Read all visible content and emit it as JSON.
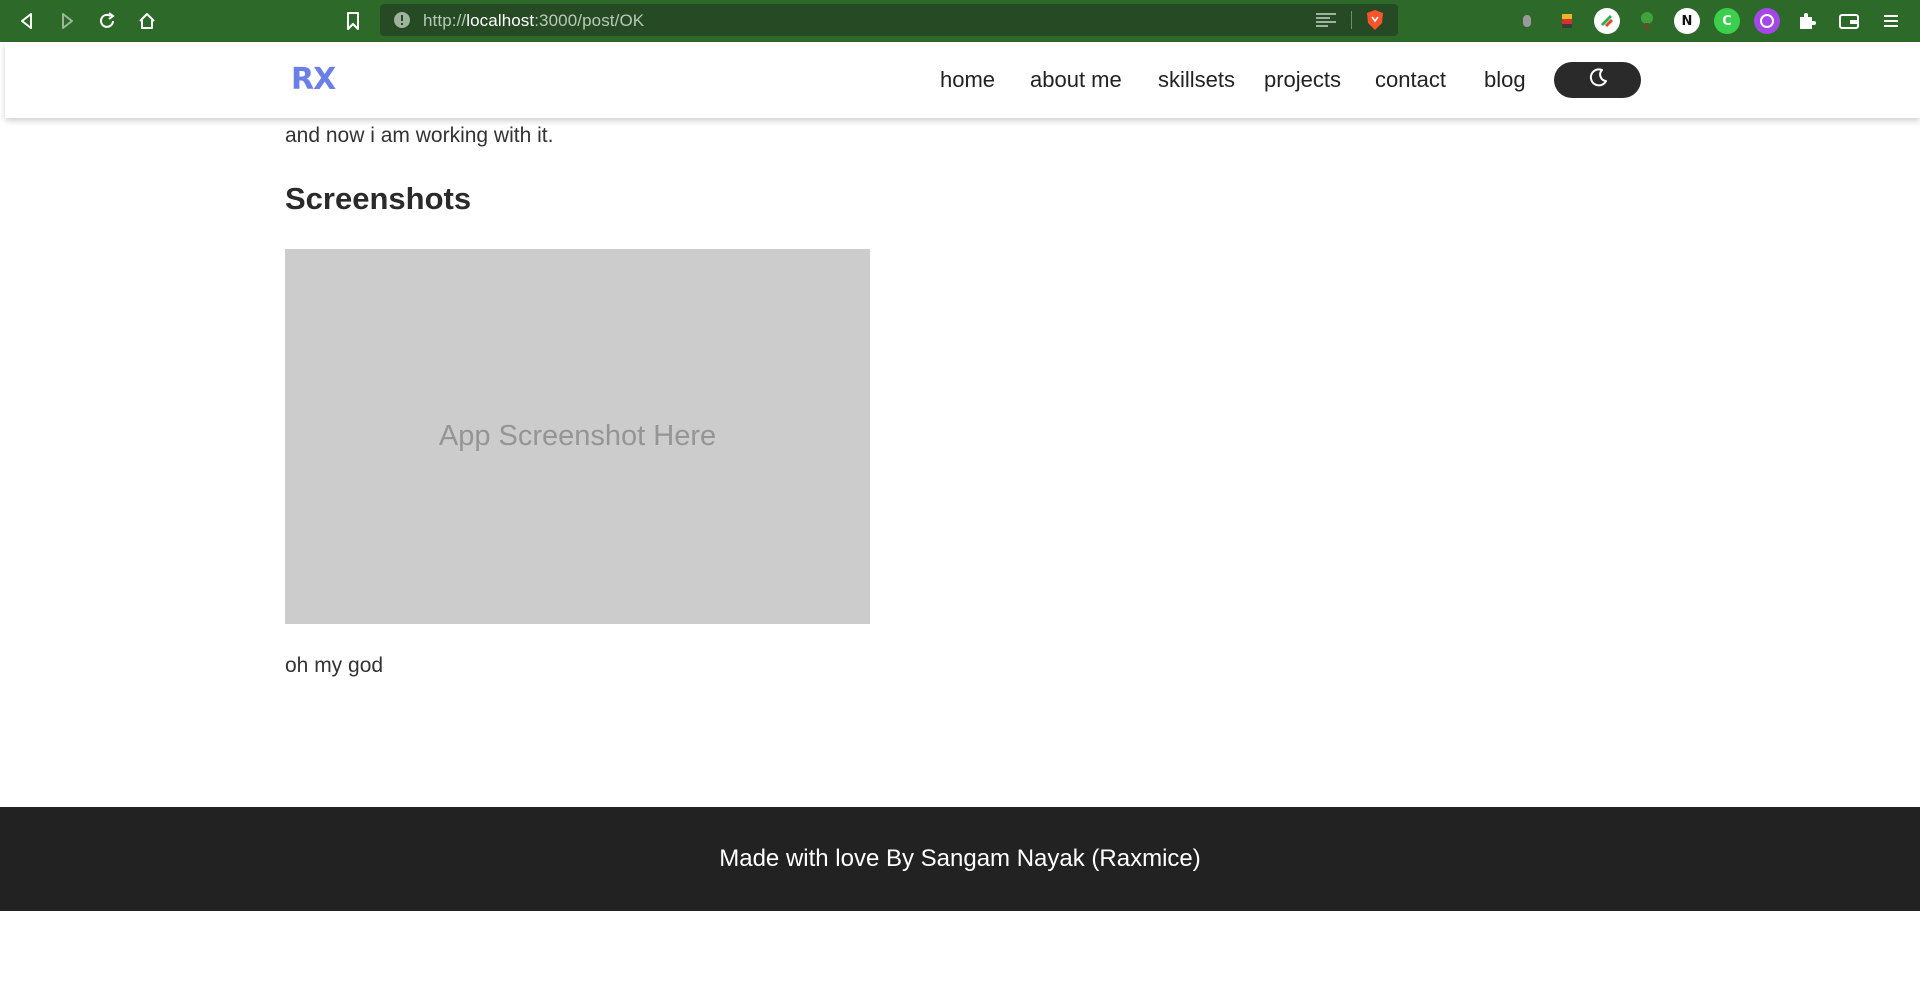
{
  "browser": {
    "url_prefix": "http://",
    "url_host": "localhost",
    "url_path": ":3000/post/OK",
    "extension_n_label": "N",
    "extension_c_label": "C"
  },
  "header": {
    "logo": "RX",
    "nav": [
      "home",
      "about me",
      "skillsets",
      "projects",
      "contact",
      "blog"
    ]
  },
  "content": {
    "intro_text": "and now i am working with it.",
    "section_title": "Screenshots",
    "placeholder_text": "App Screenshot Here",
    "after_text": "oh my god"
  },
  "footer": {
    "text": "Made with love By Sangam Nayak (Raxmice)"
  }
}
